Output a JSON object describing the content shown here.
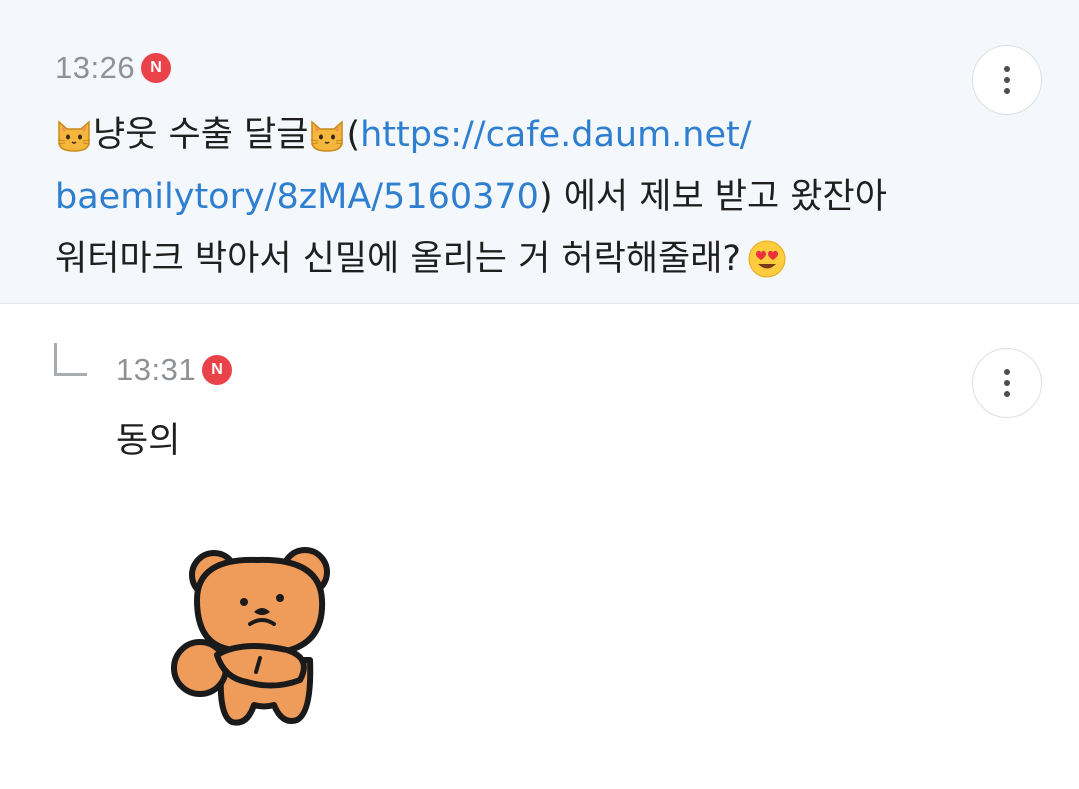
{
  "comments": [
    {
      "time": "13:26",
      "badge": "N",
      "lines": [
        {
          "pre": "냥웃 수출 달글",
          "post": "(",
          "link": "https://cafe.daum.net/"
        },
        {
          "link": "baemilytory/8zMA/5160370",
          "text": ") 에서 제보 받고 왔잔아"
        },
        {
          "text": "워터마크 박아서 신밀에 올리는 거 허락해줄래?"
        }
      ],
      "icons": [
        "cat-face-emoji",
        "heart-eyes-emoji"
      ]
    },
    {
      "time": "13:31",
      "badge": "N",
      "text": "동의",
      "sticker": "bear-sticker"
    }
  ],
  "colors": {
    "highlight_bg": "#f4f7fb",
    "link": "#2f7fd0",
    "badge": "#e94248",
    "time": "#8e9296"
  }
}
